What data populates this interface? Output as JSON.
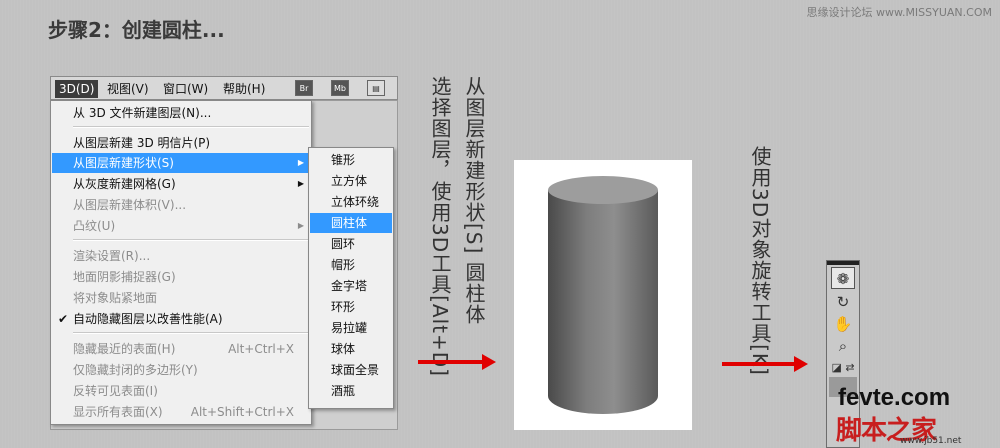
{
  "title": "步骤2：创建圆柱...",
  "watermark": "思缘设计论坛 www.MISSYUAN.COM",
  "menubar": {
    "items": [
      {
        "label": "3D(D)",
        "active": true
      },
      {
        "label": "视图(V)"
      },
      {
        "label": "窗口(W)"
      },
      {
        "label": "帮助(H)"
      }
    ],
    "icons": [
      "Br",
      "Mb"
    ]
  },
  "menu": {
    "items": [
      {
        "label": "从 3D 文件新建图层(N)...",
        "disabled": false
      },
      {
        "label": "从图层新建 3D 明信片(P)",
        "disabled": false
      },
      {
        "label": "从图层新建形状(S)",
        "selected": true,
        "submenu": true
      },
      {
        "label": "从灰度新建网格(G)",
        "submenu": true
      },
      {
        "label": "从图层新建体积(V)...",
        "disabled": true
      },
      {
        "label": "凸纹(U)",
        "disabled": true,
        "submenu": true
      },
      {
        "label": "渲染设置(R)...",
        "disabled": true
      },
      {
        "label": "地面阴影捕捉器(G)",
        "disabled": true
      },
      {
        "label": "将对象贴紧地面",
        "disabled": true
      },
      {
        "label": "自动隐藏图层以改善性能(A)",
        "checked": true
      },
      {
        "label": "隐藏最近的表面(H)",
        "shortcut": "Alt+Ctrl+X",
        "disabled": true
      },
      {
        "label": "仅隐藏封闭的多边形(Y)",
        "disabled": true
      },
      {
        "label": "反转可见表面(I)",
        "disabled": true
      },
      {
        "label": "显示所有表面(X)",
        "shortcut": "Alt+Shift+Ctrl+X",
        "disabled": true
      }
    ]
  },
  "submenu": {
    "items": [
      "锥形",
      "立方体",
      "立体环绕",
      "圆柱体",
      "圆环",
      "帽形",
      "金字塔",
      "环形",
      "易拉罐",
      "球体",
      "球面全景",
      "酒瓶"
    ],
    "selected_index": 3
  },
  "annotations": {
    "step_a": "选择图层，使用3D工具[Alt+D]",
    "step_b": "从图层新建形状[S] 圆柱体",
    "step_c": "使用3D对象旋转工具[K]"
  },
  "logo": {
    "line1": "fevte.com",
    "line2": "脚本之家",
    "line3": "www.jb51.net"
  },
  "colors": {
    "highlight": "#3399ff",
    "arrow": "#e00000"
  }
}
